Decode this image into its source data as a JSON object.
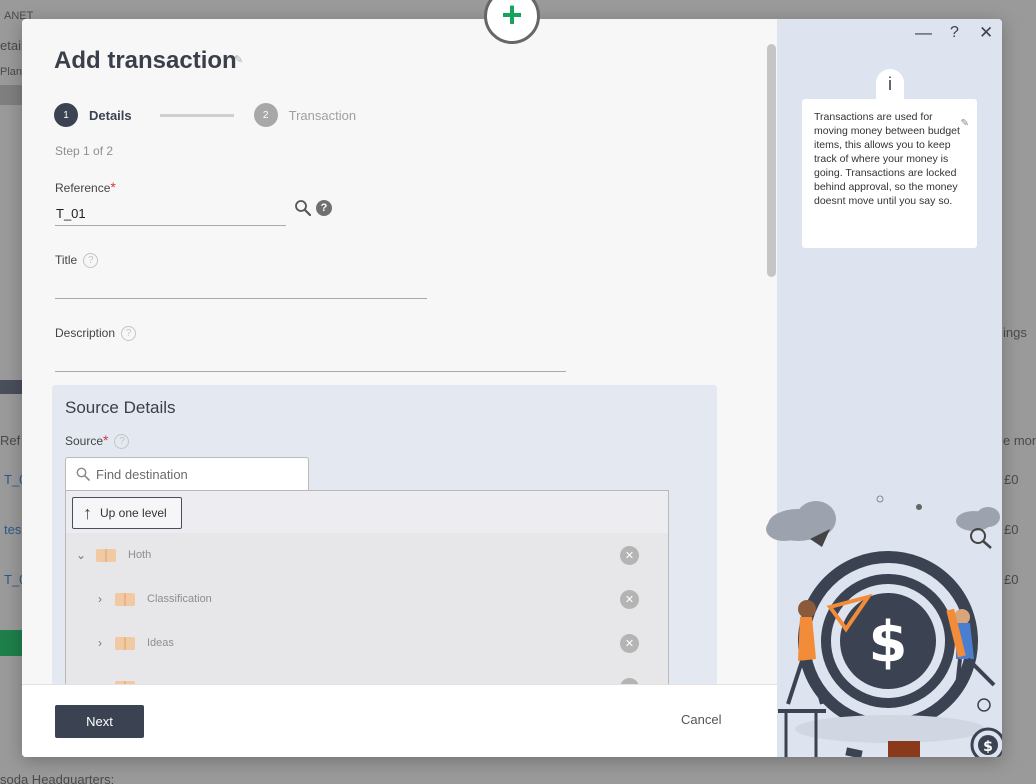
{
  "background": {
    "text_planet": "ANET",
    "text_detail": "etail",
    "text_plan": "Plan",
    "tab_right": "ings",
    "col_ref": "Ref",
    "col_mon": "e mon",
    "row1": "T_0",
    "row2": "tes",
    "row3": "T_0",
    "row_val1": "£0",
    "row_val2": "£0",
    "row_val3": "£0",
    "footer_text": "soda Headquarters:"
  },
  "modal": {
    "title": "Add transaction",
    "stepper": {
      "steps": [
        {
          "number": "1",
          "label": "Details"
        },
        {
          "number": "2",
          "label": "Transaction"
        }
      ],
      "step_count": "Step 1 of 2"
    },
    "fields": {
      "reference": {
        "label": "Reference",
        "value": "T_01"
      },
      "title": {
        "label": "Title",
        "value": ""
      },
      "description": {
        "label": "Description",
        "value": ""
      }
    },
    "source": {
      "heading": "Source Details",
      "label": "Source",
      "search_placeholder": "Find destination",
      "up_button": "Up one level",
      "tree": [
        {
          "label": "Hoth",
          "expanded": true,
          "level": 0
        },
        {
          "label": "Classification",
          "expanded": false,
          "level": 1
        },
        {
          "label": "Ideas",
          "expanded": false,
          "level": 1
        }
      ]
    },
    "footer": {
      "next": "Next",
      "cancel": "Cancel"
    },
    "controls": {
      "minimize": "—",
      "help": "?",
      "close": "✕"
    },
    "info": {
      "icon": "i",
      "text": "Transactions are used for moving money between budget items, this allows you to keep track of where your money is going. Transactions are locked behind approval, so the money doesnt move until you say so."
    }
  },
  "colors": {
    "primary": "#3b4252",
    "accent_green": "#16a35a",
    "required": "#d9363e",
    "side_bg": "#dde3ef"
  }
}
